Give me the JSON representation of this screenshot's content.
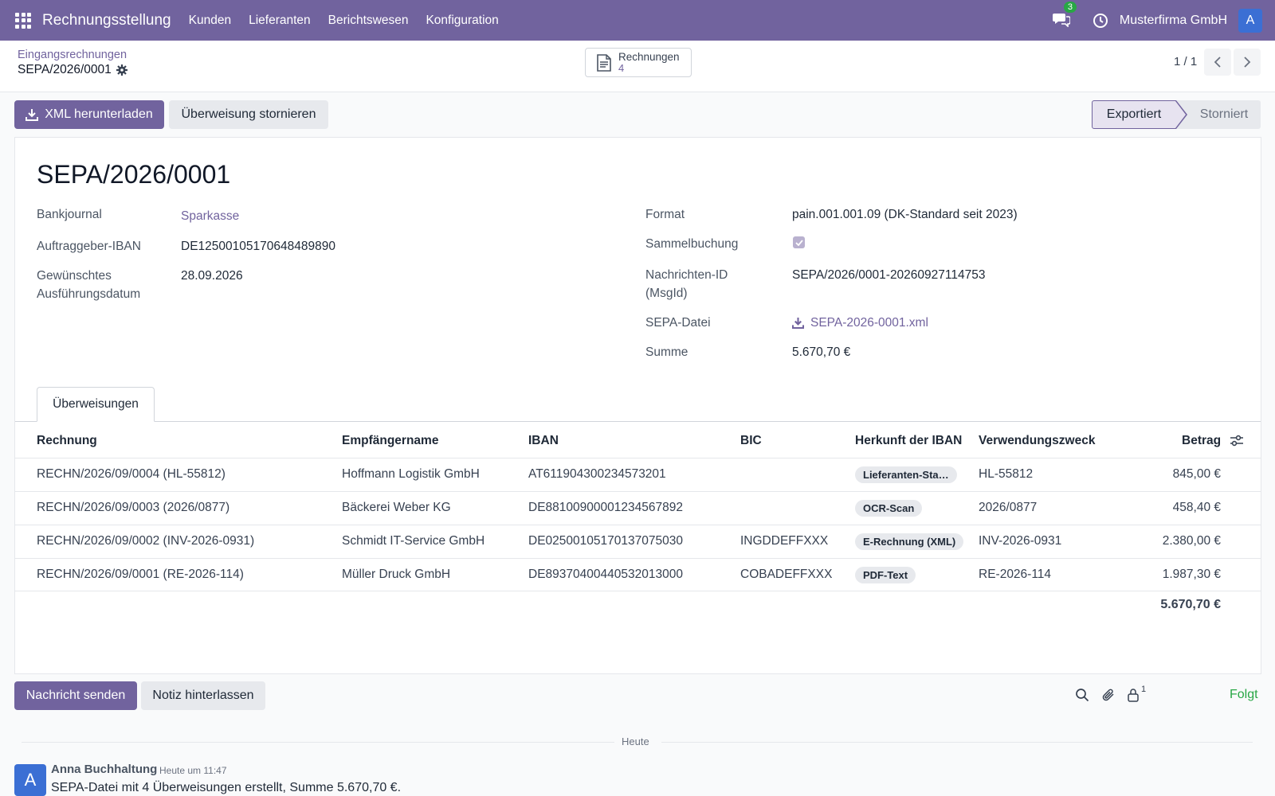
{
  "navbar": {
    "app_title": "Rechnungsstellung",
    "menu": [
      "Kunden",
      "Lieferanten",
      "Berichtswesen",
      "Konfiguration"
    ],
    "chat_badge": "3",
    "company": "Musterfirma GmbH",
    "user_initial": "A"
  },
  "control": {
    "breadcrumb": "Eingangsrechnungen",
    "record": "SEPA/2026/0001",
    "smart_button": {
      "label": "Rechnungen",
      "count": "4"
    },
    "pager": "1 / 1"
  },
  "actions": {
    "download_xml": "XML herunterladen",
    "cancel_transfer": "Überweisung stornieren"
  },
  "status": {
    "active": "Exportiert",
    "next": "Storniert"
  },
  "form": {
    "title": "SEPA/2026/0001",
    "left": [
      {
        "label": "Bankjournal",
        "value": "Sparkasse"
      },
      {
        "label": "Auftraggeber-IBAN",
        "value": "DE12500105170648489890"
      },
      {
        "label": "Gewünschtes Ausführungsdatum",
        "value": "28.09.2026"
      }
    ],
    "right": [
      {
        "label": "Format",
        "value": "pain.001.001.09 (DK-Standard seit 2023)"
      },
      {
        "label": "Sammelbuchung",
        "value": ""
      },
      {
        "label": "Nachrichten-ID (MsgId)",
        "value": "SEPA/2026/0001-20260927114753"
      },
      {
        "label": "SEPA-Datei",
        "value": "SEPA-2026-0001.xml"
      },
      {
        "label": "Summe",
        "value": "5.670,70 €"
      }
    ],
    "sammelbuchung_checked": true
  },
  "tabs": [
    "Überweisungen"
  ],
  "table": {
    "headers": [
      "Rechnung",
      "Empfängername",
      "IBAN",
      "BIC",
      "Herkunft der IBAN",
      "Verwendungszweck",
      "Betrag"
    ],
    "rows": [
      [
        "RECHN/2026/09/0004 (HL-55812)",
        "Hoffmann Logistik GmbH",
        "AT611904300234573201",
        "",
        "Lieferanten-Sta…",
        "HL-55812",
        "845,00 €"
      ],
      [
        "RECHN/2026/09/0003 (2026/0877)",
        "Bäckerei Weber KG",
        "DE88100900001234567892",
        "",
        "OCR-Scan",
        "2026/0877",
        "458,40 €"
      ],
      [
        "RECHN/2026/09/0002 (INV-2026-0931)",
        "Schmidt IT-Service GmbH",
        "DE02500105170137075030",
        "INGDDEFFXXX",
        "E-Rechnung (XML)",
        "INV-2026-0931",
        "2.380,00 €"
      ],
      [
        "RECHN/2026/09/0001 (RE-2026-114)",
        "Müller Druck GmbH",
        "DE89370400440532013000",
        "COBADEFFXXX",
        "PDF-Text",
        "RE-2026-114",
        "1.987,30 €"
      ]
    ],
    "total": "5.670,70 €"
  },
  "chatter": {
    "send_message": "Nachricht senden",
    "log_note": "Notiz hinterlassen",
    "followers": "1",
    "follow_label": "Folgt",
    "date_separator": "Heute",
    "message": {
      "author": "Anna Buchhaltung",
      "time": "Heute um 11:47",
      "initial": "A",
      "body": "SEPA-Datei mit 4 Überweisungen erstellt, Summe 5.670,70 €."
    }
  },
  "colors": {
    "brand": "#71639e",
    "follow": "#28a745",
    "badge": "#28a745",
    "avatar": "#3b6fd4"
  }
}
